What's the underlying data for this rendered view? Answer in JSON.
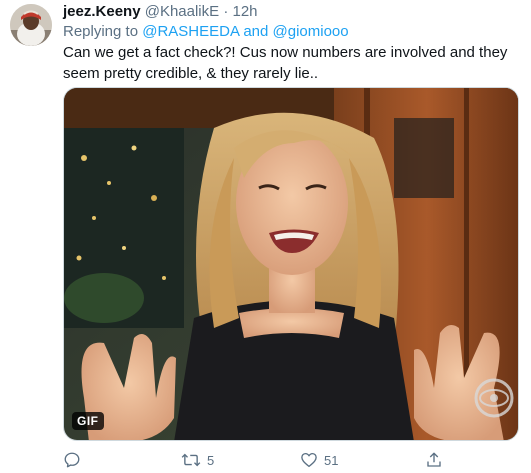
{
  "tweet": {
    "display_name": "jeez.Keeny",
    "handle": "@KhaalikE",
    "separator": "·",
    "time": "12h",
    "replying_prefix": "Replying to",
    "replying_user1": "@RASHEEDA",
    "replying_and": "and",
    "replying_user2": "@giomiooo",
    "text": "Can we get a fact check?! Cus now numbers are involved and they seem pretty credible, & they rarely lie..",
    "media": {
      "badge": "GIF"
    },
    "actions": {
      "reply_icon": "reply-icon",
      "retweet_icon": "retweet-icon",
      "retweet_count": "5",
      "like_icon": "heart-icon",
      "like_count": "51",
      "share_icon": "share-icon"
    }
  },
  "colors": {
    "link": "#1da1f2",
    "secondary_text": "#5b7083",
    "primary_text": "#0f1419"
  }
}
